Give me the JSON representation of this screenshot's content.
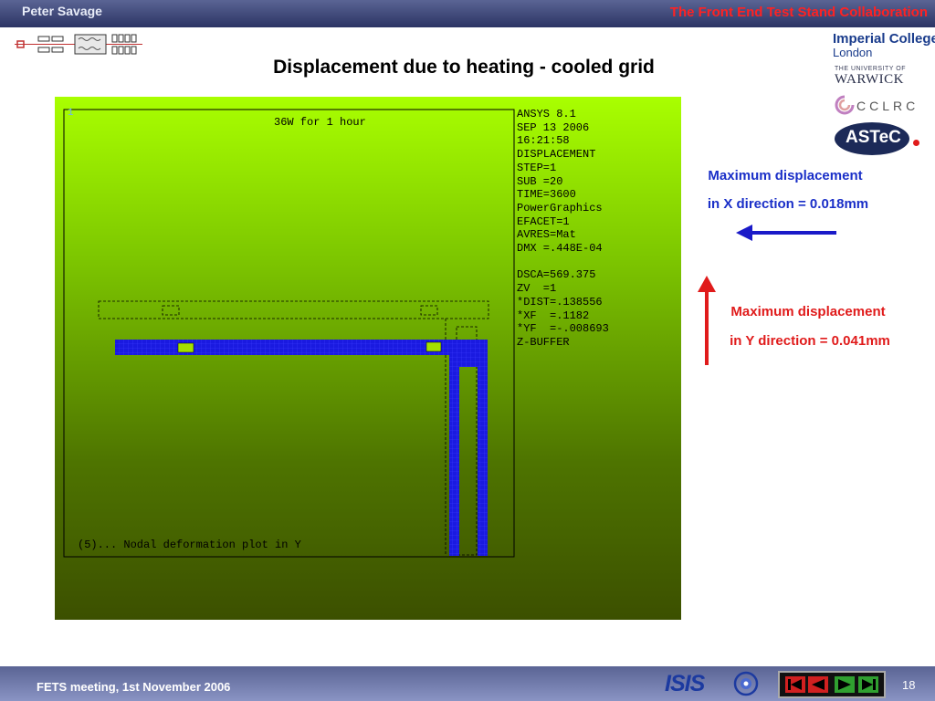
{
  "header": {
    "author": "Peter Savage",
    "collaboration": "The Front End Test Stand Collaboration"
  },
  "logos": {
    "imperial_line1": "Imperial College",
    "imperial_line2": "London",
    "warwick_line1": "THE UNIVERSITY OF",
    "warwick_line2": "WARWICK",
    "cclrc": "CCLRC",
    "astec": "ASTeC"
  },
  "slide": {
    "title": "Displacement due to heating - cooled grid"
  },
  "plot": {
    "corner_label": "1",
    "title": "36W for 1 hour",
    "caption": "(5)... Nodal deformation plot in Y",
    "ansys_info": [
      "ANSYS 8.1",
      "SEP 13 2006",
      "16:21:58",
      "DISPLACEMENT",
      "STEP=1",
      "SUB =20",
      "TIME=3600",
      "PowerGraphics",
      "EFACET=1",
      "AVRES=Mat",
      "DMX =.448E-04",
      "",
      "DSCA=569.375",
      "ZV  =1",
      "*DIST=.138556",
      "*XF  =.1182",
      "*YF  =-.008693",
      "Z-BUFFER"
    ],
    "colors": {
      "mesh": "#1a1ae0",
      "background_top": "#a9ff00",
      "background_bottom": "#3c5000"
    }
  },
  "annotations": {
    "x_line1": "Maximum displacement",
    "x_line2": "in X direction = 0.018mm",
    "x_color": "#1a2fc8",
    "y_line1": "Maximum displacement",
    "y_line2": "in Y direction = 0.041mm",
    "y_color": "#e01b1b"
  },
  "footer": {
    "meeting": "FETS meeting, 1st November 2006",
    "isis": "ISIS",
    "page": "18"
  },
  "nav_icons": [
    "first-slide-icon",
    "previous-slide-icon",
    "next-slide-icon",
    "last-slide-icon"
  ]
}
